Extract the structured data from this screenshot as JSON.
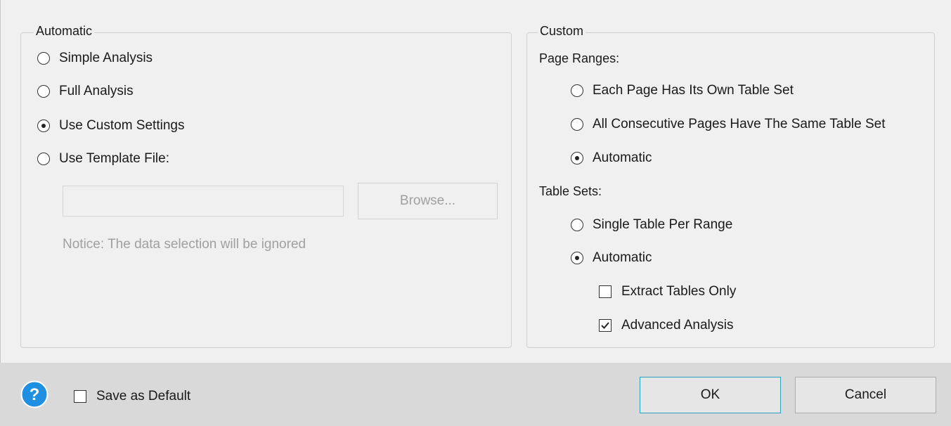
{
  "automatic": {
    "legend": "Automatic",
    "options": [
      {
        "label": "Simple Analysis",
        "checked": false
      },
      {
        "label": "Full Analysis",
        "checked": false
      },
      {
        "label": "Use Custom Settings",
        "checked": true
      },
      {
        "label": "Use Template File:",
        "checked": false
      }
    ],
    "template_file_value": "",
    "browse_label": "Browse...",
    "notice": "Notice: The data selection will be ignored"
  },
  "custom": {
    "legend": "Custom",
    "page_ranges_label": "Page Ranges:",
    "page_ranges": [
      {
        "label": "Each Page Has Its Own Table Set",
        "checked": false
      },
      {
        "label": "All Consecutive Pages Have The Same Table Set",
        "checked": false
      },
      {
        "label": "Automatic",
        "checked": true
      }
    ],
    "table_sets_label": "Table Sets:",
    "table_sets": [
      {
        "label": "Single Table Per Range",
        "checked": false
      },
      {
        "label": "Automatic",
        "checked": true
      }
    ],
    "extract_tables_only": {
      "label": "Extract Tables Only",
      "checked": false
    },
    "advanced_analysis": {
      "label": "Advanced Analysis",
      "checked": true
    }
  },
  "footer": {
    "help_icon": "question-mark-icon",
    "save_default": {
      "label": "Save as Default",
      "checked": false
    },
    "ok_label": "OK",
    "cancel_label": "Cancel"
  },
  "colors": {
    "help_blue": "#1e8fe1",
    "ok_border": "#2aa1c0",
    "disabled_text": "#a0a0a0",
    "footer_bg": "#d9d9d9"
  }
}
